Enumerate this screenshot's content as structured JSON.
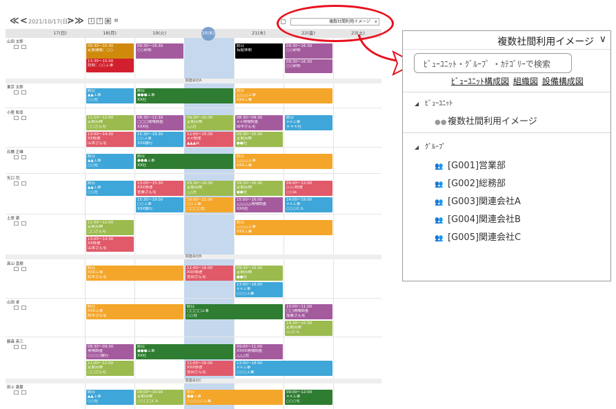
{
  "toolbar": {
    "nav_prev_week": "≪",
    "nav_prev_day": "<",
    "date": "2021/10/17(日)",
    "nav_next_day": ">",
    "nav_next_week": "≫",
    "view_select": "複数社間利用イメージ"
  },
  "days": [
    "17(日)",
    "18(月)",
    "19(火)",
    "20(水)",
    "21(木)",
    "22(金)",
    "23(土)"
  ],
  "groups": [
    "関連会社A",
    "関連会社B",
    "関連会社C"
  ],
  "people": [
    "山田 太郎",
    "東京 太郎",
    "小陸 和幸",
    "石橋 正雄",
    "矢口 司",
    "土居 康",
    "髙山 直樹",
    "山田 卓",
    "藤森 英三",
    "田上 康夏"
  ],
  "events": [
    {
      "lines": [
        "09:30～10:30",
        "定期連絡：○○"
      ],
      "color": "#cf8a0c"
    },
    {
      "lines": [
        "13:30～15:00",
        "訪問：○○工事"
      ],
      "color": "#d21f2d"
    },
    {
      "lines": [
        "09:30～16:30",
        "○○研修"
      ],
      "color": "#a45b9e"
    },
    {
      "lines": [
        "終日",
        "有給休暇"
      ],
      "color": "#000000"
    },
    {
      "lines": [
        "09:30～16:30",
        "○○研修"
      ],
      "color": "#a45b9e"
    },
    {
      "lines": [
        "09:30～16:30",
        "○○研修"
      ],
      "color": "#a45b9e"
    },
    {
      "lines": [
        "終日",
        "▲▲工事",
        "○○社"
      ],
      "color": "#3ea6d8"
    },
    {
      "lines": [
        "終日",
        "●●●工事",
        "XX社"
      ],
      "color": "#2e7d32"
    },
    {
      "lines": [
        "終日",
        "△△△△工事",
        "XXX工業"
      ],
      "color": "#f4a62a"
    },
    {
      "lines": [
        "11:00～12:00",
        "定期点検",
        "□□さん宅"
      ],
      "color": "#9bbb4f"
    },
    {
      "lines": [
        "13:00～14:30",
        "XX修理",
        "山本さん宅"
      ],
      "color": "#e05a6a"
    },
    {
      "lines": [
        "08:30～12:30",
        "□□□現場調査",
        "XXX社"
      ],
      "color": "#a45b9e"
    },
    {
      "lines": [
        "15:30～19:30",
        "○○工事",
        "XXX銀行"
      ],
      "color": "#3ea6d8"
    },
    {
      "lines": [
        "09:30～10:30",
        "定期点検",
        "△△社"
      ],
      "color": "#9bbb4f"
    },
    {
      "lines": [
        "11:00～15:30",
        "××修理",
        "▲▲▲店"
      ],
      "color": "#e05a6a"
    },
    {
      "lines": [
        "08:30～09:30",
        "××現場調査",
        "田中さん宅"
      ],
      "color": "#a45b9e"
    },
    {
      "lines": [
        "09:30～10:30",
        "定期点検",
        "●●社"
      ],
      "color": "#9bbb4f"
    },
    {
      "lines": [
        "終日",
        "××工事",
        "＊＊＊社"
      ],
      "color": "#3ea6d8"
    },
    {
      "lines": [
        "終日",
        "▲▲工事",
        "○○社"
      ],
      "color": "#3ea6d8"
    },
    {
      "lines": [
        "終日",
        "●●●工事",
        "XX社"
      ],
      "color": "#2e7d32"
    },
    {
      "lines": [
        "終日",
        "△△△△工事",
        "XXX工業"
      ],
      "color": "#f4a62a"
    },
    {
      "lines": [
        "終日",
        "▲▲工事",
        "○○社"
      ],
      "color": "#3ea6d8"
    },
    {
      "lines": [
        "13:00～15:30",
        "XXX修理",
        "佐藤さん宅"
      ],
      "color": "#e05a6a"
    },
    {
      "lines": [
        "15:30～19:00",
        "○○工事",
        "XXX銀行"
      ],
      "color": "#3ea6d8"
    },
    {
      "lines": [
        "09:30～10:30",
        "定期点検",
        "△△社"
      ],
      "color": "#9bbb4f"
    },
    {
      "lines": [
        "16:00～21:00",
        "○○工事",
        "□□□□社"
      ],
      "color": "#f4a62a"
    },
    {
      "lines": [
        "09:30～10:30",
        "定期点検",
        "●●社"
      ],
      "color": "#9bbb4f"
    },
    {
      "lines": [
        "15:00～16:00",
        "△△△△△現場調査",
        "XXX社"
      ],
      "color": "#a45b9e"
    },
    {
      "lines": [
        "09:00～12:00",
        "◇◇◇修理",
        "○○店"
      ],
      "color": "#e05a6a"
    },
    {
      "lines": [
        "14:00～19:00",
        "××工事",
        "○○○ビル"
      ],
      "color": "#3ea6d8"
    },
    {
      "lines": [
        "11:00～12:00",
        "定期点検",
        "□□さん宅"
      ],
      "color": "#9bbb4f"
    },
    {
      "lines": [
        "13:00～14:30",
        "XX修理",
        "山本さん宅"
      ],
      "color": "#e05a6a"
    },
    {
      "lines": [
        "終日",
        "△△△△工事",
        "XXX工業"
      ],
      "color": "#f4a62a"
    },
    {
      "lines": [
        "終日",
        "XXX工事",
        "鈴木さん宅"
      ],
      "color": "#f4a62a"
    },
    {
      "lines": [
        "11:00～16:00",
        "XXX修理",
        "吉田さん宅"
      ],
      "color": "#e05a6a"
    },
    {
      "lines": [
        "09:30～10:30",
        "定期点検",
        "●●社"
      ],
      "color": "#9bbb4f"
    },
    {
      "lines": [
        "13:00～18:00",
        "××工事",
        "○○○工業"
      ],
      "color": "#3ea6d8"
    },
    {
      "lines": [
        "終日",
        "XXX工事",
        "鈴木さん宅"
      ],
      "color": "#f4a62a"
    },
    {
      "lines": [
        "終日",
        "□□□□工事",
        "○○社"
      ],
      "color": "#2e7d32"
    },
    {
      "lines": [
        "10:00～11:00",
        "□□現場調査",
        "加藤さん宅"
      ],
      "color": "#a45b9e"
    },
    {
      "lines": [
        "14:30～15:30",
        "定期点検",
        "◇◇ビル"
      ],
      "color": "#9bbb4f"
    },
    {
      "lines": [
        "08:30～09:30",
        "現場調査",
        "○○○○銀行"
      ],
      "color": "#a45b9e"
    },
    {
      "lines": [
        "11:00～12:00",
        "定期点検",
        "□□さん宅"
      ],
      "color": "#9bbb4f"
    },
    {
      "lines": [
        "終日",
        "●●●工事",
        "XX社"
      ],
      "color": "#2e7d32"
    },
    {
      "lines": [
        "11:00～16:00",
        "XXX修理",
        "吉田さん宅"
      ],
      "color": "#e05a6a"
    },
    {
      "lines": [
        "09:00～11:00",
        "XXXX現場調査",
        "△△△社"
      ],
      "color": "#a45b9e"
    },
    {
      "lines": [
        "13:00～18:00",
        "××工事",
        "○○○工業"
      ],
      "color": "#3ea6d8"
    },
    {
      "lines": [
        "終日",
        "▲▲工事",
        "○○社"
      ],
      "color": "#3ea6d8"
    },
    {
      "lines": [
        "09:00～10:00",
        "定期点検",
        "○○□□ビル"
      ],
      "color": "#9bbb4f"
    },
    {
      "lines": [
        "終日",
        "●●工事",
        "○○○○○工業"
      ],
      "color": "#f4a62a"
    },
    {
      "lines": [
        "09:00～12:00",
        "××工事",
        "○○○宅"
      ],
      "color": "#2e7d32"
    }
  ],
  "panel": {
    "title": "複数社間利用イメージ",
    "search_placeholder": "ﾋﾞｭｰﾕﾆｯﾄ・ｸﾞﾙｰﾌﾟ ・ｶﾃｺﾞﾘｰで検索",
    "links": [
      "ﾋﾞｭｰﾕﾆｯﾄ構成図",
      "組織図",
      "設備構成図"
    ],
    "view_unit_header": "ﾋﾞｭｰﾕﾆｯﾄ",
    "view_units": [
      "複数社間利用イメージ"
    ],
    "group_header": "ｸﾞﾙｰﾌﾟ",
    "groups": [
      "[G001]営業部",
      "[G002]総務部",
      "[G003]関連会社A",
      "[G004]関連会社B",
      "[G005]関連会社C"
    ]
  },
  "colors": {
    "highlight": "#e8101e",
    "today": "#c5d8ee",
    "today_badge": "#7aa0ce"
  }
}
